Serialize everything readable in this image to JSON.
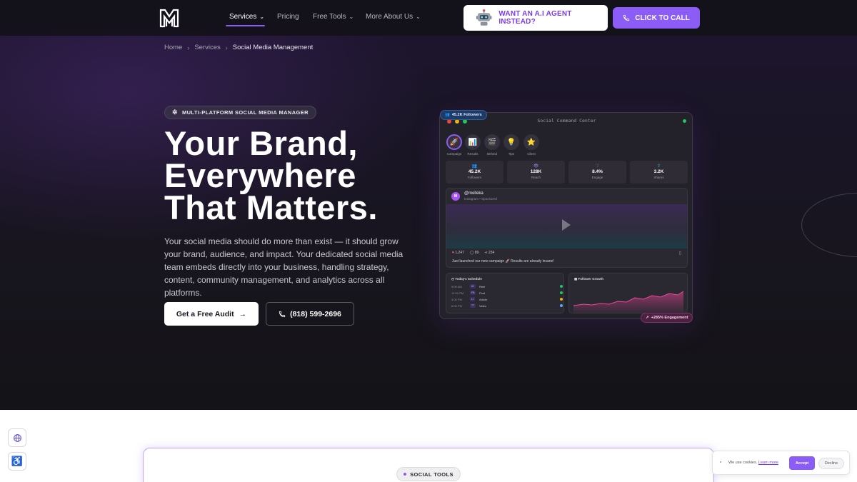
{
  "nav": {
    "items": [
      {
        "label": "Services",
        "chevron": true
      },
      {
        "label": "Pricing",
        "chevron": false
      },
      {
        "label": "Free Tools",
        "chevron": true
      },
      {
        "label": "More About Us",
        "chevron": true
      }
    ],
    "agent_cta": "WANT AN A.I AGENT INSTEAD?",
    "call_cta": "CLICK TO CALL"
  },
  "breadcrumb": {
    "home": "Home",
    "services": "Services",
    "current": "Social Media Management"
  },
  "hero": {
    "pill": "MULTI-PLATFORM SOCIAL MEDIA MANAGER",
    "headline": [
      "Your Brand,",
      "Everywhere",
      "That Matters."
    ],
    "description": "Your social media should do more than exist — it should grow your brand, audience, and impact. Your dedicated social media team embeds directly into your business, handling strategy, content, community management, and analytics across all platforms.",
    "audit_button": "Get a Free Audit",
    "phone_button": "(818) 599-2696"
  },
  "dashboard": {
    "title": "Social Command Center",
    "followers_badge": "45.2K Followers",
    "engagement_badge": "+285% Engagement",
    "stories": [
      {
        "label": "Campaign",
        "icon": "🚀"
      },
      {
        "label": "Results",
        "icon": "📊"
      },
      {
        "label": "Behind",
        "icon": "🎬"
      },
      {
        "label": "Tips",
        "icon": "💡"
      },
      {
        "label": "Client",
        "icon": "⭐"
      }
    ],
    "stats": [
      {
        "value": "45.2K",
        "label": "Followers",
        "icon": "👥",
        "color": "#60a5fa"
      },
      {
        "value": "128K",
        "label": "Reach",
        "icon": "👁",
        "color": "#a78bfa"
      },
      {
        "value": "8.4%",
        "label": "Engage",
        "icon": "♡",
        "color": "#f472b6"
      },
      {
        "value": "3.2K",
        "label": "Shares",
        "icon": "⇪",
        "color": "#22d3ee"
      }
    ],
    "post": {
      "avatar": "M",
      "user": "@melleka",
      "sub": "Instagram • Sponsored",
      "likes": "1,247",
      "comments": "89",
      "shares": "234",
      "caption": "Just launched our new campaign 🚀 Results are already insane!"
    },
    "schedule": {
      "title": "Today's Schedule",
      "rows": [
        {
          "time": "9:00 AM",
          "tag": "IG",
          "kind": "Reel",
          "color": "#22c55e"
        },
        {
          "time": "12:00 PM",
          "tag": "FB",
          "kind": "Post",
          "color": "#22c55e"
        },
        {
          "time": "3:00 PM",
          "tag": "LI",
          "kind": "Article",
          "color": "#eab308"
        },
        {
          "time": "6:00 PM",
          "tag": "TT",
          "kind": "Video",
          "color": "#60a5fa"
        }
      ]
    },
    "growth": {
      "title": "Follower Growth"
    }
  },
  "bottom": {
    "tools_pill": "SOCIAL TOOLS",
    "cookie_text": "We use cookies.",
    "cookie_link": "Learn more",
    "accept": "Accept",
    "decline": "Decline"
  },
  "colors": {
    "accent": "#8b5cf6",
    "hero_bg": "#17151d"
  }
}
